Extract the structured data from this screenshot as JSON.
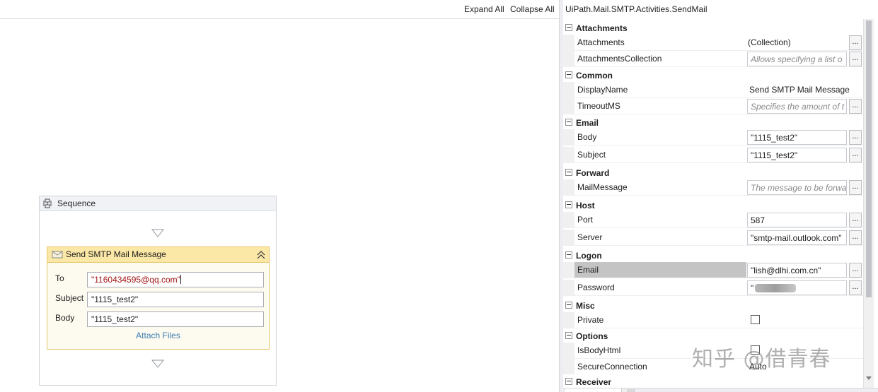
{
  "designer": {
    "toolbar": {
      "expand_all": "Expand All",
      "collapse_all": "Collapse All"
    },
    "sequence": {
      "title": "Sequence",
      "activity": {
        "title": "Send SMTP Mail Message",
        "fields": {
          "to_label": "To",
          "to_value": "\"1160434595@qq.com\"",
          "subject_label": "Subject",
          "subject_value": "\"1115_test2\"",
          "body_label": "Body",
          "body_value": "\"1115_test2\""
        },
        "attach_files": "Attach Files"
      }
    }
  },
  "properties": {
    "title": "UiPath.Mail.SMTP.Activities.SendMail",
    "ellipsis": "...",
    "categories": {
      "attachments": {
        "name": "Attachments",
        "attachments": {
          "name": "Attachments",
          "value": "(Collection)"
        },
        "attachments_collection": {
          "name": "AttachmentsCollection",
          "placeholder": "Allows specifying a list o"
        }
      },
      "common": {
        "name": "Common",
        "display_name": {
          "name": "DisplayName",
          "value": "Send SMTP Mail Message"
        },
        "timeout_ms": {
          "name": "TimeoutMS",
          "placeholder": "Specifies the amount of t"
        }
      },
      "email": {
        "name": "Email",
        "body": {
          "name": "Body",
          "value": "\"1115_test2\""
        },
        "subject": {
          "name": "Subject",
          "value": "\"1115_test2\""
        }
      },
      "forward": {
        "name": "Forward",
        "mail_message": {
          "name": "MailMessage",
          "placeholder": "The message to be forwa"
        }
      },
      "host": {
        "name": "Host",
        "port": {
          "name": "Port",
          "value": "587"
        },
        "server": {
          "name": "Server",
          "value": "\"smtp-mail.outlook.com\""
        }
      },
      "logon": {
        "name": "Logon",
        "email": {
          "name": "Email",
          "value": "\"lish@dlhi.com.cn\""
        },
        "password": {
          "name": "Password",
          "value": "\""
        }
      },
      "misc": {
        "name": "Misc",
        "private": {
          "name": "Private",
          "checked": false
        }
      },
      "options": {
        "name": "Options",
        "is_body_html": {
          "name": "IsBodyHtml",
          "checked": false
        },
        "secure_connection": {
          "name": "SecureConnection",
          "value": "Auto"
        }
      },
      "receiver": {
        "name": "Receiver"
      }
    }
  },
  "watermark": "知乎 @借青春",
  "colors": {
    "activity_header": "#fbe7a6",
    "activity_border": "#e6c66a",
    "link_blue": "#3c7fb1",
    "string_literal": "#a31515",
    "selected_row": "#c4c4c4"
  }
}
